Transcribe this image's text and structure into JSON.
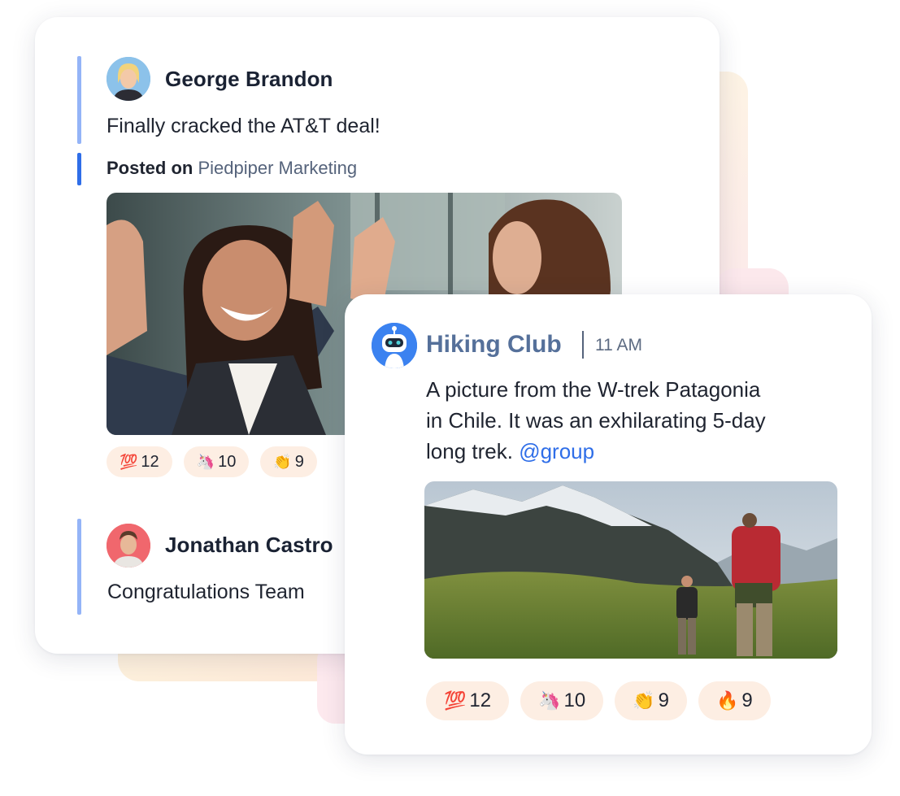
{
  "feed_post": {
    "author": "George Brandon",
    "message": "Finally cracked the AT&T deal!",
    "posted_label": "Posted on",
    "channel": "Piedpiper Marketing",
    "reactions": [
      {
        "emoji": "💯",
        "emoji_name": "hundred-points-icon",
        "count": "12"
      },
      {
        "emoji": "🦄",
        "emoji_name": "unicorn-icon",
        "count": "10"
      },
      {
        "emoji": "👏",
        "emoji_name": "clapping-hands-icon",
        "count": "9"
      }
    ]
  },
  "reply_post": {
    "author": "Jonathan Castro",
    "message": "Congratulations Team"
  },
  "hiking_post": {
    "group": "Hiking Club",
    "time": "11 AM",
    "message_lines": [
      "A picture from the W-trek Patagonia",
      "in Chile. It was an exhilarating 5-day",
      "long trek."
    ],
    "mention": "@group",
    "reactions": [
      {
        "emoji": "💯",
        "emoji_name": "hundred-points-icon",
        "count": "12"
      },
      {
        "emoji": "🦄",
        "emoji_name": "unicorn-icon",
        "count": "10"
      },
      {
        "emoji": "👏",
        "emoji_name": "clapping-hands-icon",
        "count": "9"
      },
      {
        "emoji": "🔥",
        "emoji_name": "fire-icon",
        "count": "9"
      }
    ]
  },
  "colors": {
    "accent_blue": "#2f6ee8",
    "thread_bar": "#94b4f7",
    "reaction_bg": "#fdeee3",
    "group_name": "#55709a"
  }
}
